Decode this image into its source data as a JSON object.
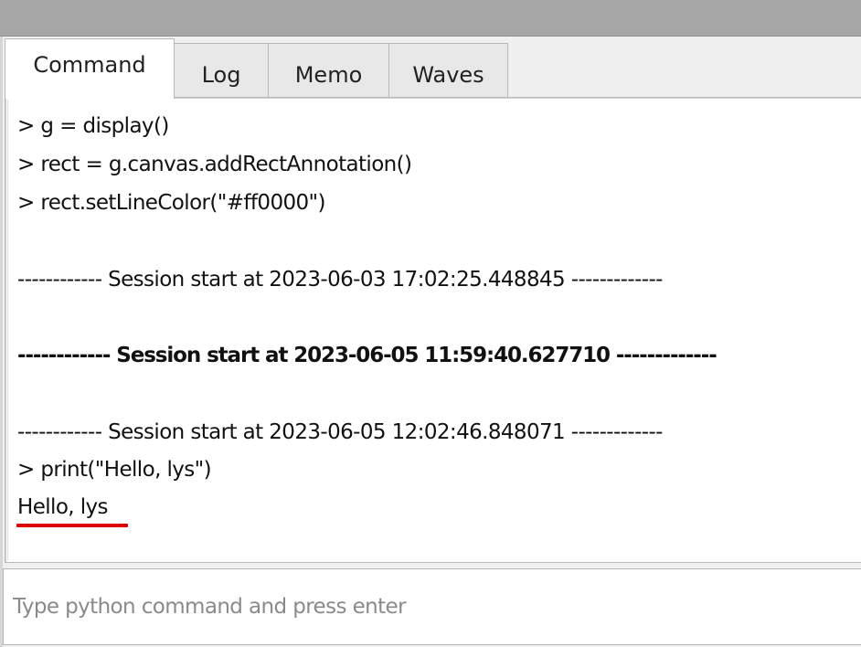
{
  "tabs": [
    {
      "label": "Command",
      "active": true
    },
    {
      "label": "Log",
      "active": false
    },
    {
      "label": "Memo",
      "active": false
    },
    {
      "label": "Waves",
      "active": false
    }
  ],
  "console": {
    "lines": [
      "> g = display()",
      "> rect = g.canvas.addRectAnnotation()",
      "> rect.setLineColor(\"#ff0000\")",
      "",
      "------------ Session start at 2023-06-03 17:02:25.448845 -------------",
      "",
      "------------ Session start at 2023-06-05 11:59:40.627710 -------------",
      "",
      "------------ Session start at 2023-06-05 12:02:46.848071 -------------",
      "> print(\"Hello, lys\")",
      "Hello, lys"
    ]
  },
  "input": {
    "value": "",
    "placeholder": "Type python command and press enter"
  },
  "colors": {
    "titlebar": "#a6a6a6",
    "annotation_underline": "#e00000"
  }
}
